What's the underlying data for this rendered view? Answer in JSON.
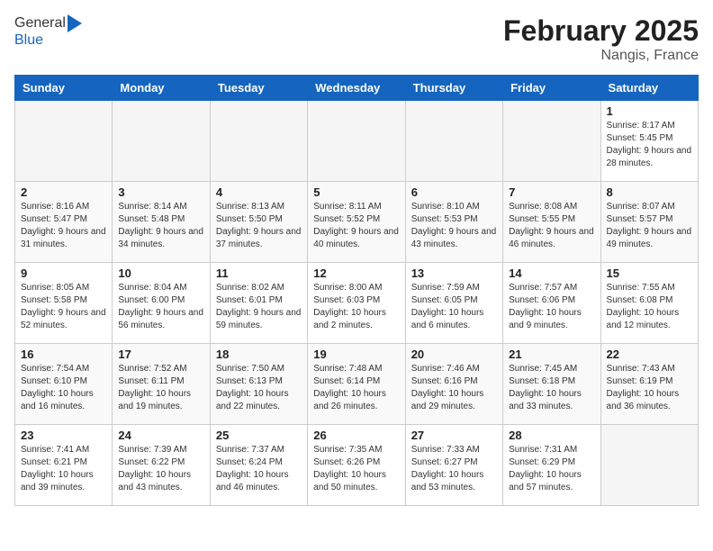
{
  "header": {
    "logo_general": "General",
    "logo_blue": "Blue",
    "month_year": "February 2025",
    "location": "Nangis, France"
  },
  "days_of_week": [
    "Sunday",
    "Monday",
    "Tuesday",
    "Wednesday",
    "Thursday",
    "Friday",
    "Saturday"
  ],
  "weeks": [
    [
      {
        "day": "",
        "info": ""
      },
      {
        "day": "",
        "info": ""
      },
      {
        "day": "",
        "info": ""
      },
      {
        "day": "",
        "info": ""
      },
      {
        "day": "",
        "info": ""
      },
      {
        "day": "",
        "info": ""
      },
      {
        "day": "1",
        "info": "Sunrise: 8:17 AM\nSunset: 5:45 PM\nDaylight: 9 hours and 28 minutes."
      }
    ],
    [
      {
        "day": "2",
        "info": "Sunrise: 8:16 AM\nSunset: 5:47 PM\nDaylight: 9 hours and 31 minutes."
      },
      {
        "day": "3",
        "info": "Sunrise: 8:14 AM\nSunset: 5:48 PM\nDaylight: 9 hours and 34 minutes."
      },
      {
        "day": "4",
        "info": "Sunrise: 8:13 AM\nSunset: 5:50 PM\nDaylight: 9 hours and 37 minutes."
      },
      {
        "day": "5",
        "info": "Sunrise: 8:11 AM\nSunset: 5:52 PM\nDaylight: 9 hours and 40 minutes."
      },
      {
        "day": "6",
        "info": "Sunrise: 8:10 AM\nSunset: 5:53 PM\nDaylight: 9 hours and 43 minutes."
      },
      {
        "day": "7",
        "info": "Sunrise: 8:08 AM\nSunset: 5:55 PM\nDaylight: 9 hours and 46 minutes."
      },
      {
        "day": "8",
        "info": "Sunrise: 8:07 AM\nSunset: 5:57 PM\nDaylight: 9 hours and 49 minutes."
      }
    ],
    [
      {
        "day": "9",
        "info": "Sunrise: 8:05 AM\nSunset: 5:58 PM\nDaylight: 9 hours and 52 minutes."
      },
      {
        "day": "10",
        "info": "Sunrise: 8:04 AM\nSunset: 6:00 PM\nDaylight: 9 hours and 56 minutes."
      },
      {
        "day": "11",
        "info": "Sunrise: 8:02 AM\nSunset: 6:01 PM\nDaylight: 9 hours and 59 minutes."
      },
      {
        "day": "12",
        "info": "Sunrise: 8:00 AM\nSunset: 6:03 PM\nDaylight: 10 hours and 2 minutes."
      },
      {
        "day": "13",
        "info": "Sunrise: 7:59 AM\nSunset: 6:05 PM\nDaylight: 10 hours and 6 minutes."
      },
      {
        "day": "14",
        "info": "Sunrise: 7:57 AM\nSunset: 6:06 PM\nDaylight: 10 hours and 9 minutes."
      },
      {
        "day": "15",
        "info": "Sunrise: 7:55 AM\nSunset: 6:08 PM\nDaylight: 10 hours and 12 minutes."
      }
    ],
    [
      {
        "day": "16",
        "info": "Sunrise: 7:54 AM\nSunset: 6:10 PM\nDaylight: 10 hours and 16 minutes."
      },
      {
        "day": "17",
        "info": "Sunrise: 7:52 AM\nSunset: 6:11 PM\nDaylight: 10 hours and 19 minutes."
      },
      {
        "day": "18",
        "info": "Sunrise: 7:50 AM\nSunset: 6:13 PM\nDaylight: 10 hours and 22 minutes."
      },
      {
        "day": "19",
        "info": "Sunrise: 7:48 AM\nSunset: 6:14 PM\nDaylight: 10 hours and 26 minutes."
      },
      {
        "day": "20",
        "info": "Sunrise: 7:46 AM\nSunset: 6:16 PM\nDaylight: 10 hours and 29 minutes."
      },
      {
        "day": "21",
        "info": "Sunrise: 7:45 AM\nSunset: 6:18 PM\nDaylight: 10 hours and 33 minutes."
      },
      {
        "day": "22",
        "info": "Sunrise: 7:43 AM\nSunset: 6:19 PM\nDaylight: 10 hours and 36 minutes."
      }
    ],
    [
      {
        "day": "23",
        "info": "Sunrise: 7:41 AM\nSunset: 6:21 PM\nDaylight: 10 hours and 39 minutes."
      },
      {
        "day": "24",
        "info": "Sunrise: 7:39 AM\nSunset: 6:22 PM\nDaylight: 10 hours and 43 minutes."
      },
      {
        "day": "25",
        "info": "Sunrise: 7:37 AM\nSunset: 6:24 PM\nDaylight: 10 hours and 46 minutes."
      },
      {
        "day": "26",
        "info": "Sunrise: 7:35 AM\nSunset: 6:26 PM\nDaylight: 10 hours and 50 minutes."
      },
      {
        "day": "27",
        "info": "Sunrise: 7:33 AM\nSunset: 6:27 PM\nDaylight: 10 hours and 53 minutes."
      },
      {
        "day": "28",
        "info": "Sunrise: 7:31 AM\nSunset: 6:29 PM\nDaylight: 10 hours and 57 minutes."
      },
      {
        "day": "",
        "info": ""
      }
    ]
  ]
}
